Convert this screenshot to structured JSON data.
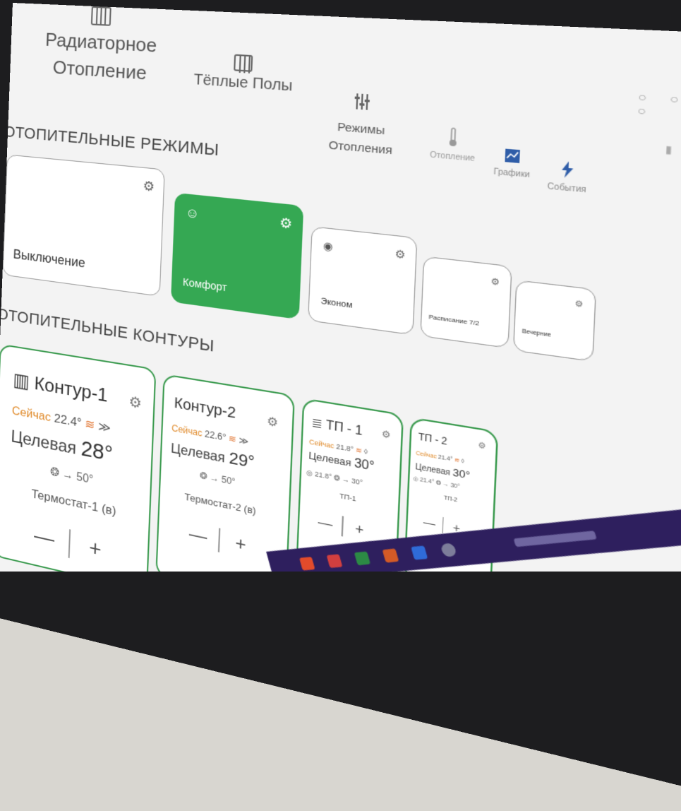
{
  "nav": {
    "radiator_line1": "Радиаторное",
    "radiator_line2": "Отопление",
    "floor_label": "Тёплые Полы",
    "modes_line1": "Режимы",
    "modes_line2": "Отопления",
    "heat_label": "Отопление",
    "graphs_label": "Графики",
    "events_label": "События"
  },
  "sections": {
    "modes_title": "ОТОПИТЕЛЬНЫЕ РЕЖИМЫ",
    "circuits_title": "ОТОПИТЕЛЬНЫЕ КОНТУРЫ"
  },
  "modes": [
    {
      "label": "Выключение",
      "active": false
    },
    {
      "label": "Комфорт",
      "active": true
    },
    {
      "label": "Эконом",
      "active": false
    },
    {
      "label": "Расписание 7/2",
      "active": false
    },
    {
      "label": "Вечерние",
      "active": false
    }
  ],
  "circuits": [
    {
      "title": "Контур-1",
      "now_label": "Сейчас",
      "now_value": "22.4°",
      "target_label": "Целевая",
      "target_value": "28°",
      "flow": "→ 50°",
      "thermostat": "Термостат-1 (в)"
    },
    {
      "title": "Контур-2",
      "now_label": "Сейчас",
      "now_value": "22.6°",
      "target_label": "Целевая",
      "target_value": "29°",
      "flow": "→ 50°",
      "thermostat": "Термостат-2 (в)"
    },
    {
      "title": "ТП - 1",
      "now_label": "Сейчас",
      "now_value": "21.8°",
      "target_label": "Целевая",
      "target_value": "30°",
      "floor_temp": "21.8°",
      "flow": "→ 30°",
      "thermostat": "ТП-1"
    },
    {
      "title": "ТП - 2",
      "now_label": "Сейчас",
      "now_value": "21.4°",
      "target_label": "Целевая",
      "target_value": "30°",
      "floor_temp": "21.4°",
      "flow": "→ 30°",
      "thermostat": "ТП-2"
    }
  ],
  "stepper": {
    "minus": "—",
    "plus": "+"
  },
  "icons": {
    "radiator": "radiator-icon",
    "floor": "floor-heating-icon",
    "modes": "sliders-icon",
    "heat": "thermometer-icon",
    "graphs": "chart-icon",
    "events": "lightning-icon",
    "settings": "gear-icon"
  },
  "colors": {
    "accent_green": "#35a853",
    "now_orange": "#e08a2a",
    "taskbar": "#2e1f5e"
  }
}
